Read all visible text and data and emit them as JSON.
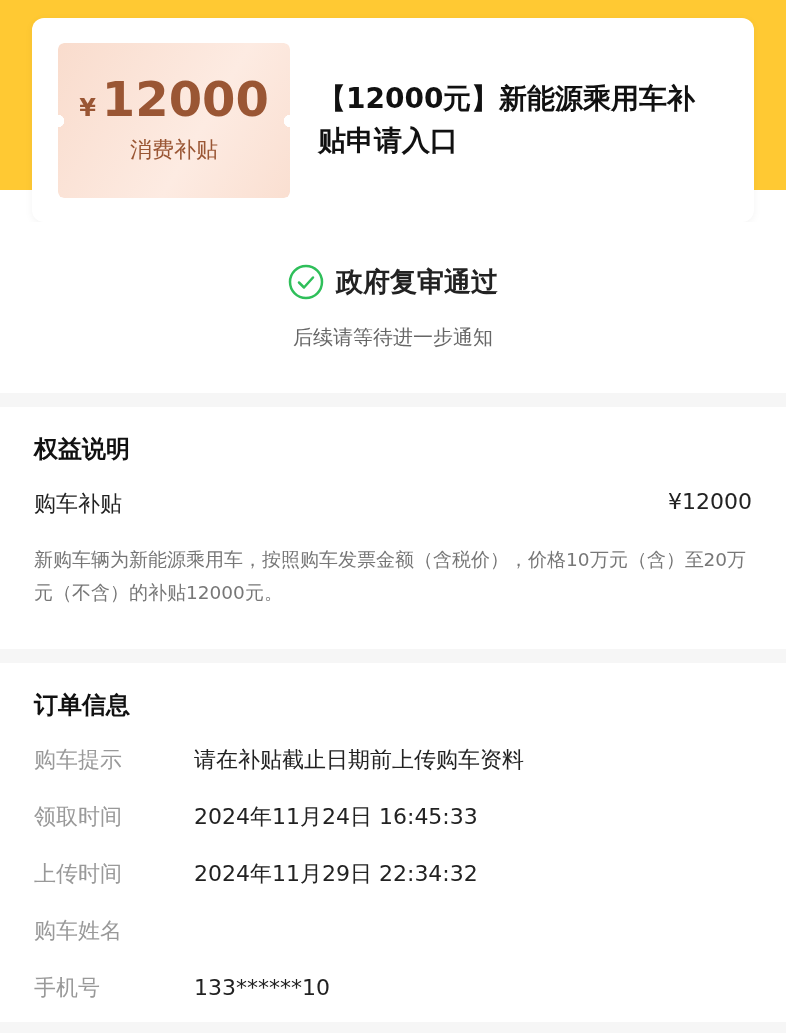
{
  "coupon": {
    "currency": "¥",
    "amount": "12000",
    "label": "消费补贴"
  },
  "title": "【12000元】新能源乘用车补贴申请入口",
  "status": {
    "kind": "approved",
    "text": "政府复审通过",
    "note": "后续请等待进一步通知"
  },
  "benefits": {
    "heading": "权益说明",
    "item": {
      "name": "购车补贴",
      "amount": "¥12000"
    },
    "description": "新购车辆为新能源乘用车，按照购车发票金额（含税价），价格10万元（含）至20万元（不含）的补贴12000元。"
  },
  "order": {
    "heading": "订单信息",
    "rows": [
      {
        "label": "购车提示",
        "value": "请在补贴截止日期前上传购车资料"
      },
      {
        "label": "领取时间",
        "value": "2024年11月24日 16:45:33"
      },
      {
        "label": "上传时间",
        "value": "2024年11月29日 22:34:32"
      },
      {
        "label": "购车姓名"
      },
      {
        "label": "手机号",
        "value": "133******10"
      }
    ]
  }
}
